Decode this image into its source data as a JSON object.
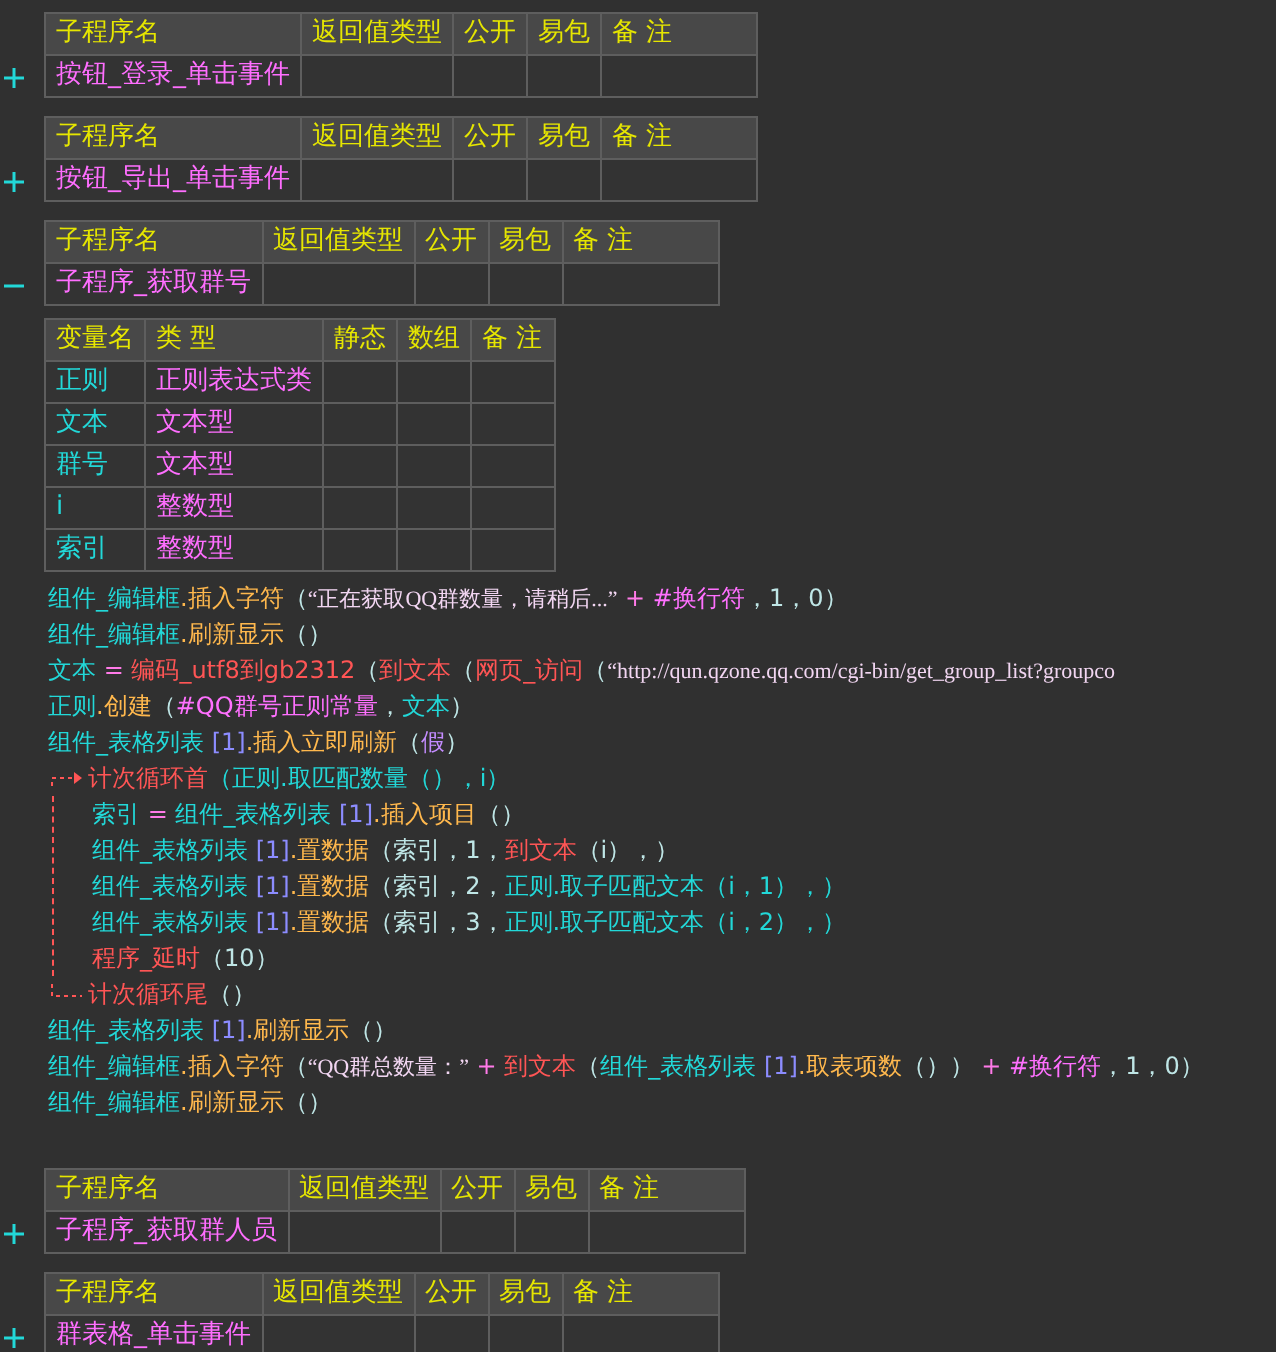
{
  "subroutines": [
    {
      "name": "按钮_登录_单击事件",
      "expanded": false,
      "columns": [
        "子程序名",
        "返回值类型",
        "公开",
        "易包",
        "备 注"
      ]
    },
    {
      "name": "按钮_导出_单击事件",
      "expanded": false,
      "columns": [
        "子程序名",
        "返回值类型",
        "公开",
        "易包",
        "备 注"
      ]
    },
    {
      "name": "子程序_获取群号",
      "expanded": true,
      "columns": [
        "子程序名",
        "返回值类型",
        "公开",
        "易包",
        "备 注"
      ],
      "locals": {
        "columns": [
          "变量名",
          "类 型",
          "静态",
          "数组",
          "备 注"
        ],
        "rows": [
          {
            "name": "正则",
            "type": "正则表达式类"
          },
          {
            "name": "文本",
            "type": "文本型"
          },
          {
            "name": "群号",
            "type": "文本型"
          },
          {
            "name": "i",
            "type": "整数型"
          },
          {
            "name": "索引",
            "type": "整数型"
          }
        ]
      },
      "code": [
        {
          "kind": "stmt",
          "tokens": [
            {
              "kind": "comp",
              "text": "组件_编辑框"
            },
            {
              "kind": "method",
              "text": ".插入字符"
            },
            {
              "kind": "punct",
              "text": "（"
            },
            {
              "kind": "str",
              "text": "“正在获取QQ群数量，请稍后...”"
            },
            {
              "kind": "op",
              "text": " + "
            },
            {
              "kind": "const",
              "text": "#换行符"
            },
            {
              "kind": "punct",
              "text": "，1，0）"
            }
          ]
        },
        {
          "kind": "stmt",
          "tokens": [
            {
              "kind": "comp",
              "text": "组件_编辑框"
            },
            {
              "kind": "method",
              "text": ".刷新显示"
            },
            {
              "kind": "punct",
              "text": "（）"
            }
          ]
        },
        {
          "kind": "stmt",
          "tokens": [
            {
              "kind": "var",
              "text": "文本"
            },
            {
              "kind": "op",
              "text": " = "
            },
            {
              "kind": "cmd",
              "text": "编码_utf8到gb2312"
            },
            {
              "kind": "punct",
              "text": "（"
            },
            {
              "kind": "cmd",
              "text": "到文本"
            },
            {
              "kind": "punct",
              "text": "（"
            },
            {
              "kind": "cmd",
              "text": "网页_访问"
            },
            {
              "kind": "punct",
              "text": "（"
            },
            {
              "kind": "str",
              "text": "“http://qun.qzone.qq.com/cgi-bin/get_group_list?groupco"
            }
          ]
        },
        {
          "kind": "stmt",
          "tokens": [
            {
              "kind": "var",
              "text": "正则"
            },
            {
              "kind": "method",
              "text": ".创建"
            },
            {
              "kind": "punct",
              "text": "（"
            },
            {
              "kind": "const",
              "text": "#QQ群号正则常量"
            },
            {
              "kind": "punct",
              "text": "，"
            },
            {
              "kind": "var",
              "text": "文本"
            },
            {
              "kind": "punct",
              "text": "）"
            }
          ]
        },
        {
          "kind": "stmt",
          "tokens": [
            {
              "kind": "comp",
              "text": "组件_表格列表"
            },
            {
              "kind": "idx",
              "text": " [1]"
            },
            {
              "kind": "method",
              "text": ".插入立即刷新"
            },
            {
              "kind": "punct",
              "text": "（"
            },
            {
              "kind": "bool",
              "text": "假"
            },
            {
              "kind": "punct",
              "text": "）"
            }
          ]
        },
        {
          "kind": "loop",
          "head": [
            {
              "kind": "cmd",
              "text": "计次循环首"
            },
            {
              "kind": "comp",
              "text": "（正则.取匹配数量（），i）"
            }
          ],
          "children": [
            {
              "kind": "stmt",
              "tokens": [
                {
                  "kind": "var",
                  "text": "索引"
                },
                {
                  "kind": "op",
                  "text": " = "
                },
                {
                  "kind": "comp",
                  "text": "组件_表格列表"
                },
                {
                  "kind": "idx",
                  "text": " [1]"
                },
                {
                  "kind": "method",
                  "text": ".插入项目"
                },
                {
                  "kind": "punct",
                  "text": "（）"
                }
              ]
            },
            {
              "kind": "stmt",
              "tokens": [
                {
                  "kind": "comp",
                  "text": "组件_表格列表"
                },
                {
                  "kind": "idx",
                  "text": " [1]"
                },
                {
                  "kind": "method",
                  "text": ".置数据"
                },
                {
                  "kind": "punct",
                  "text": "（索引，1，"
                },
                {
                  "kind": "cmd",
                  "text": "到文本"
                },
                {
                  "kind": "punct",
                  "text": "（i），）"
                }
              ]
            },
            {
              "kind": "stmt",
              "tokens": [
                {
                  "kind": "comp",
                  "text": "组件_表格列表"
                },
                {
                  "kind": "idx",
                  "text": " [1]"
                },
                {
                  "kind": "method",
                  "text": ".置数据"
                },
                {
                  "kind": "punct",
                  "text": "（索引，2，"
                },
                {
                  "kind": "comp",
                  "text": "正则.取子匹配文本（i，1），）"
                }
              ]
            },
            {
              "kind": "stmt",
              "tokens": [
                {
                  "kind": "comp",
                  "text": "组件_表格列表"
                },
                {
                  "kind": "idx",
                  "text": " [1]"
                },
                {
                  "kind": "method",
                  "text": ".置数据"
                },
                {
                  "kind": "punct",
                  "text": "（索引，3，"
                },
                {
                  "kind": "comp",
                  "text": "正则.取子匹配文本（i，2），）"
                }
              ]
            },
            {
              "kind": "stmt",
              "tokens": [
                {
                  "kind": "cmd",
                  "text": "程序_延时"
                },
                {
                  "kind": "punct",
                  "text": "（10）"
                }
              ]
            }
          ],
          "tail": [
            {
              "kind": "cmd",
              "text": "计次循环尾"
            },
            {
              "kind": "punct",
              "text": "（）"
            }
          ]
        },
        {
          "kind": "stmt",
          "tokens": [
            {
              "kind": "comp",
              "text": "组件_表格列表"
            },
            {
              "kind": "idx",
              "text": " [1]"
            },
            {
              "kind": "method",
              "text": ".刷新显示"
            },
            {
              "kind": "punct",
              "text": "（）"
            }
          ]
        },
        {
          "kind": "stmt",
          "tokens": [
            {
              "kind": "comp",
              "text": "组件_编辑框"
            },
            {
              "kind": "method",
              "text": ".插入字符"
            },
            {
              "kind": "punct",
              "text": "（"
            },
            {
              "kind": "str",
              "text": "“QQ群总数量：”"
            },
            {
              "kind": "op",
              "text": " + "
            },
            {
              "kind": "cmd",
              "text": "到文本"
            },
            {
              "kind": "punct",
              "text": "（"
            },
            {
              "kind": "comp",
              "text": "组件_表格列表"
            },
            {
              "kind": "idx",
              "text": " [1]"
            },
            {
              "kind": "method",
              "text": ".取表项数"
            },
            {
              "kind": "punct",
              "text": "（））"
            },
            {
              "kind": "op",
              "text": " + "
            },
            {
              "kind": "const",
              "text": "#换行符"
            },
            {
              "kind": "punct",
              "text": "，1，0）"
            }
          ]
        },
        {
          "kind": "stmt",
          "tokens": [
            {
              "kind": "comp",
              "text": "组件_编辑框"
            },
            {
              "kind": "method",
              "text": ".刷新显示"
            },
            {
              "kind": "punct",
              "text": "（）"
            }
          ]
        }
      ]
    },
    {
      "name": "子程序_获取群人员",
      "expanded": false,
      "columns": [
        "子程序名",
        "返回值类型",
        "公开",
        "易包",
        "备 注"
      ]
    },
    {
      "name": "群表格_单击事件",
      "expanded": false,
      "columns": [
        "子程序名",
        "返回值类型",
        "公开",
        "易包",
        "备 注"
      ]
    }
  ]
}
